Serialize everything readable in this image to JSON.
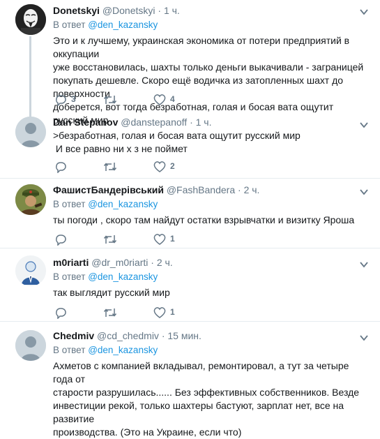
{
  "tweets": [
    {
      "name": "Donetskyi",
      "handle": "@Donetskyi",
      "dot": "·",
      "time": "1 ч.",
      "reply_prefix": "В ответ",
      "reply_to": "@den_kazansky",
      "lines": [
        "Это и к лучшему, украинская экономика от потери предприятий в оккупации",
        "уже восстановилась, шахты только деньги выкачивали - заграницей",
        "покупать дешевле. Скоро ещё водичка из затопленных шахт до поверхности",
        "доберется, вот тогда безработная, голая и босая вата ощутит русский мир"
      ],
      "replies": "3",
      "retweets": "",
      "likes": "4"
    },
    {
      "name": "Dan Stepanov",
      "handle": "@danstepanoff",
      "dot": "·",
      "time": "1 ч.",
      "lines": [
        ">безработная, голая и босая вата ощутит русский мир",
        " И все равно ни х з не поймет"
      ],
      "replies": "",
      "retweets": "",
      "likes": "2"
    },
    {
      "name": "ФашистБандерівський",
      "handle": "@FashBandera",
      "dot": "·",
      "time": "2 ч.",
      "reply_prefix": "В ответ",
      "reply_to": "@den_kazansky",
      "lines": [
        "ты погоди , скоро там найдут остатки взрывчатки и визитку Яроша"
      ],
      "replies": "",
      "retweets": "",
      "likes": "1"
    },
    {
      "name": "m0riarti",
      "handle": "@dr_m0riarti",
      "dot": "·",
      "time": "2 ч.",
      "reply_prefix": "В ответ",
      "reply_to": "@den_kazansky",
      "lines": [
        "так выглядит русский мир"
      ],
      "replies": "",
      "retweets": "",
      "likes": "1"
    },
    {
      "name": "Chedmiv",
      "handle": "@cd_chedmiv",
      "dot": "·",
      "time": "15 мин.",
      "reply_prefix": "В ответ",
      "reply_to": "@den_kazansky",
      "lines": [
        "Ахметов с компанией вкладывал, ремонтировал, а тут за четыре года от",
        "старости разрушилась...... Без эффективных собственников. Везде",
        "инвестиции рекой, только шахтеры бастуют, зарплат нет, все на развитие",
        "производства. (Это на Украине, если что)"
      ]
    }
  ],
  "colors": {
    "link": "#1b95e0",
    "secondary": "#657786",
    "divider": "#e6ecf0",
    "thread_line": "#ccd6dd"
  },
  "icons": [
    "reply-icon",
    "retweet-icon",
    "like-icon",
    "chevron-down-icon"
  ]
}
